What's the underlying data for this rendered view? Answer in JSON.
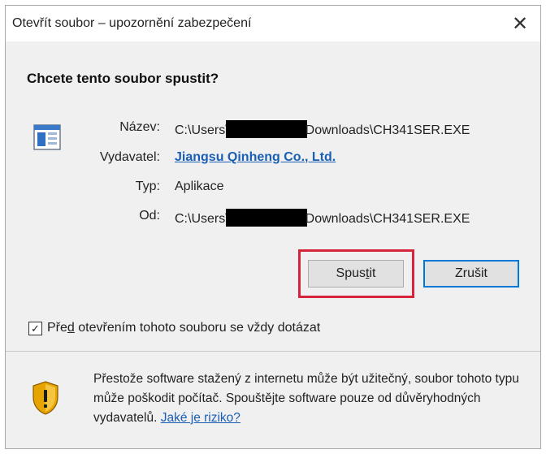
{
  "window": {
    "title": "Otevřít soubor – upozornění zabezpečení"
  },
  "question": "Chcete tento soubor spustit?",
  "fields": {
    "name_label": "Název:",
    "name_prefix": "C:\\Users\\",
    "name_suffix": "Downloads\\CH341SER.EXE",
    "publisher_label": "Vydavatel:",
    "publisher_value": "Jiangsu Qinheng Co., Ltd.",
    "type_label": "Typ:",
    "type_value": "Aplikace",
    "from_label": "Od:",
    "from_prefix": "C:\\Users\\",
    "from_suffix": "Downloads\\CH341SER.EXE"
  },
  "buttons": {
    "run_pre": "Spus",
    "run_mnemonic": "t",
    "run_post": "it",
    "cancel": "Zrušit"
  },
  "checkbox": {
    "checked": true,
    "label_pre": "Pře",
    "label_mnemonic": "d",
    "label_post": " otevřením tohoto souboru se vždy dotázat"
  },
  "warning": {
    "text": "Přestože software stažený z internetu může být užitečný, soubor tohoto typu může poškodit počítač. Spouštějte software pouze od důvěryhodných vydavatelů. ",
    "link": "Jaké je riziko?"
  },
  "colors": {
    "accent": "#0078d7",
    "highlight": "#d6253a",
    "link": "#1a5fb4"
  }
}
